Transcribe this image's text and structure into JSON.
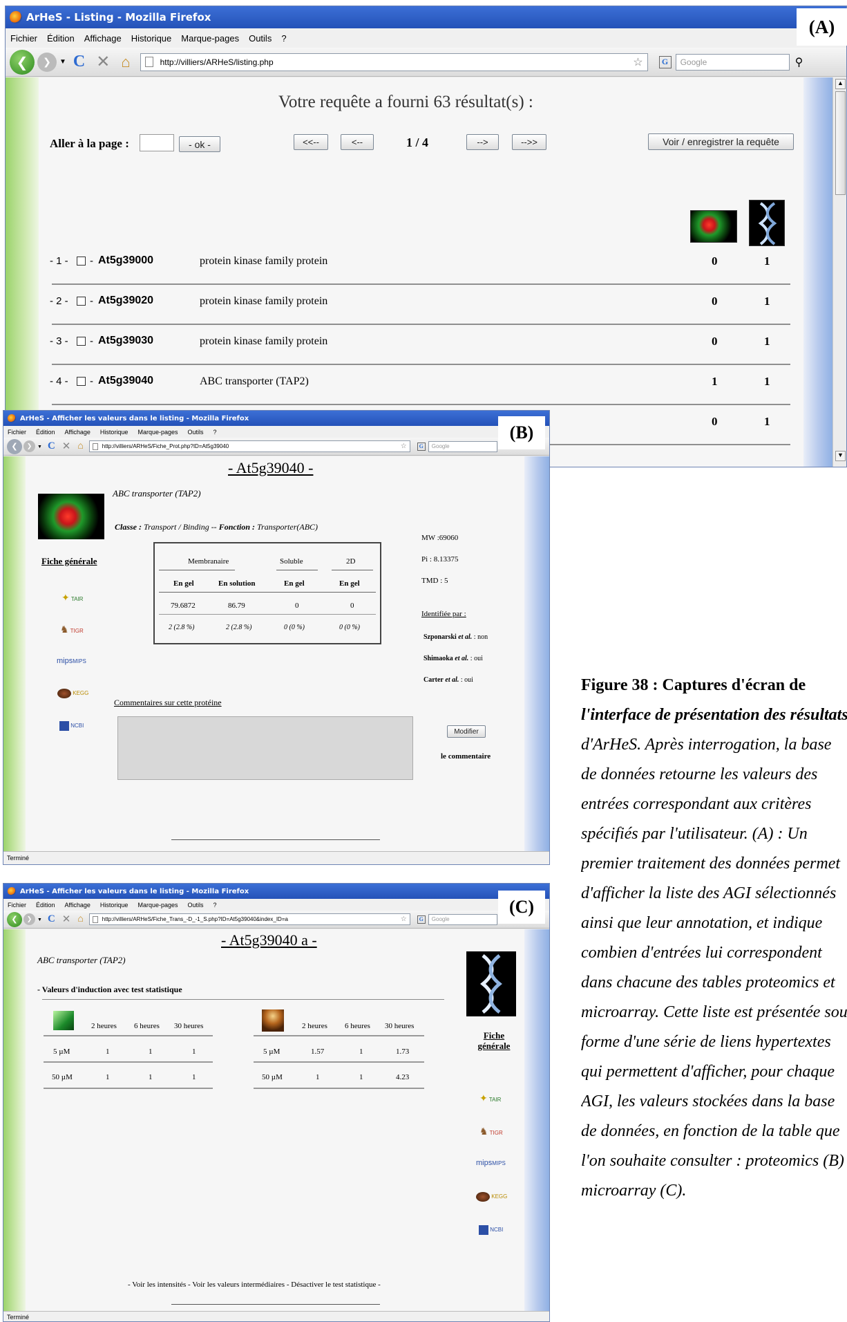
{
  "labels": {
    "a": "(A)",
    "b": "(B)",
    "c": "(C)"
  },
  "browser": {
    "menus": [
      "Fichier",
      "Édition",
      "Affichage",
      "Historique",
      "Marque-pages",
      "Outils",
      "?"
    ],
    "search_placeholder": "Google",
    "status_text": "Terminé"
  },
  "window_a": {
    "title": "ArHeS - Listing - Mozilla Firefox",
    "url": "http://villiers/ARHeS/listing.php",
    "heading": "Votre requête a fourni 63 résultat(s) :",
    "goto_label": "Aller à la page :",
    "ok_label": "- ok -",
    "first_label": "<<--",
    "prev_label": "<--",
    "page_indicator": "1 / 4",
    "next_label": "-->",
    "last_label": "-->>",
    "save_label": "Voir / enregistrer la requête",
    "rows": [
      {
        "num": "- 1 -",
        "agi": "At5g39000",
        "desc": "protein kinase family protein",
        "prot": "0",
        "micro": "1"
      },
      {
        "num": "- 2 -",
        "agi": "At5g39020",
        "desc": "protein kinase family protein",
        "prot": "0",
        "micro": "1"
      },
      {
        "num": "- 3 -",
        "agi": "At5g39030",
        "desc": "protein kinase family protein",
        "prot": "0",
        "micro": "1"
      },
      {
        "num": "- 4 -",
        "agi": "At5g39040",
        "desc": "ABC transporter (TAP2)",
        "prot": "1",
        "micro": "1"
      },
      {
        "num": "",
        "agi": "",
        "desc": "",
        "prot": "0",
        "micro": "1"
      }
    ]
  },
  "window_b": {
    "title": "ArHeS - Afficher les valeurs dans le listing - Mozilla Firefox",
    "url": "http://villiers/ARHeS/Fiche_Prot.php?ID=At5g39040",
    "heading": "- At5g39040 -",
    "annotation": "ABC transporter (TAP2)",
    "classe_label": "Classe :",
    "classe_value": "Transport / Binding --",
    "fonction_label": "Fonction :",
    "fonction_value": "Transporter(ABC)",
    "fiche_generale": "Fiche générale",
    "links": [
      "TAIR",
      "TIGR",
      "MIPS",
      "KEGG",
      "NCBI"
    ],
    "table_headers": [
      "Membranaire",
      "Soluble",
      "2D"
    ],
    "table_subheaders": [
      "En gel",
      "En solution",
      "En gel",
      "En gel"
    ],
    "table_values": [
      "79.6872",
      "86.79",
      "0",
      "0"
    ],
    "table_pct": [
      "2 (2.8 %)",
      "2 (2.8 %)",
      "0 (0 %)",
      "0 (0 %)"
    ],
    "mw": "MW :69060",
    "pi": "Pi : 8.13375",
    "tmd": "TMD : 5",
    "identified_by": "Identifiée par :",
    "authors": [
      {
        "name": "Szponarski",
        "etal": "et al.",
        "value": ": non"
      },
      {
        "name": "Shimaoka",
        "etal": "et al.",
        "value": ": oui"
      },
      {
        "name": "Carter",
        "etal": "et al.",
        "value": ": oui"
      }
    ],
    "comments_label": "Commentaires sur cette protéine",
    "modify_label": "Modifier",
    "comment_word": "le commentaire",
    "status_text": "Terminé"
  },
  "window_c": {
    "title": "ArHeS - Afficher les valeurs dans le listing - Mozilla Firefox",
    "url": "http://villiers/ARHeS/Fiche_Trans_-D_-1_S.php?ID=At5g39040&index_ID=a",
    "heading": "- At5g39040 a -",
    "annotation": "ABC transporter (TAP2)",
    "section_label": "- Valeurs d'induction avec test statistique",
    "time_headers": [
      "2 heures",
      "6 heures",
      "30 heures"
    ],
    "left_rows": [
      {
        "dose": "5 µM",
        "values": [
          "1",
          "1",
          "1"
        ]
      },
      {
        "dose": "50 µM",
        "values": [
          "1",
          "1",
          "1"
        ]
      }
    ],
    "right_rows": [
      {
        "dose": "5 µM",
        "values": [
          "1.57",
          "1",
          "1.73"
        ]
      },
      {
        "dose": "50 µM",
        "values": [
          "1",
          "1",
          "4.23"
        ]
      }
    ],
    "fiche_generale": "Fiche générale",
    "links": [
      "TAIR",
      "TIGR",
      "MIPS",
      "KEGG",
      "NCBI"
    ],
    "footer_links": "- Voir les intensités - Voir les valeurs intermédiaires - Désactiver le test statistique -",
    "status_text": "Terminé"
  },
  "caption": {
    "lines": [
      "Figure 38 : Captures d'écran de",
      "l'interface de présentation des résultats",
      "d'ArHeS. Après interrogation, la base",
      "de données retourne les valeurs des",
      "entrées correspondant aux critères",
      "spécifiés par l'utilisateur. (A) : Un",
      "premier traitement des données permet",
      "d'afficher la liste des AGI sélectionnés",
      "ainsi que leur annotation, et indique",
      "combien d'entrées lui correspondent",
      "dans chacune des tables proteomics et",
      "microarray. Cette liste est présentée sous",
      "forme d'une série de liens hypertextes",
      "qui permettent d'afficher, pour chaque",
      "AGI, les valeurs stockées dans la base",
      "de données, en fonction de la table que",
      "l'on souhaite consulter : proteomics (B)",
      "microarray (C)."
    ]
  }
}
